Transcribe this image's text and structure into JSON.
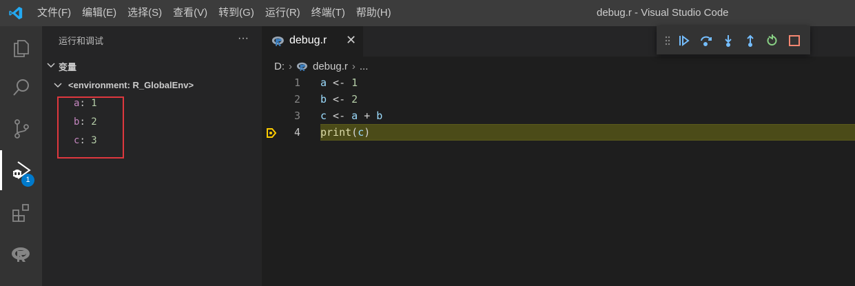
{
  "window": {
    "title": "debug.r - Visual Studio Code"
  },
  "menu": [
    {
      "label": "文件(F)"
    },
    {
      "label": "编辑(E)"
    },
    {
      "label": "选择(S)"
    },
    {
      "label": "查看(V)"
    },
    {
      "label": "转到(G)"
    },
    {
      "label": "运行(R)"
    },
    {
      "label": "终端(T)"
    },
    {
      "label": "帮助(H)"
    }
  ],
  "activitybar": {
    "items": [
      "explorer-icon",
      "search-icon",
      "source-control-icon",
      "run-debug-icon",
      "extensions-icon",
      "r-icon"
    ],
    "debug_badge": "1"
  },
  "sidebar": {
    "header": "运行和调试",
    "more": "···",
    "section": "变量",
    "environment": "<environment: R_GlobalEnv>",
    "variables": [
      {
        "name": "a",
        "value": "1"
      },
      {
        "name": "b",
        "value": "2"
      },
      {
        "name": "c",
        "value": "3"
      }
    ]
  },
  "editor": {
    "tab": {
      "label": "debug.r",
      "close": "✕"
    },
    "breadcrumb": {
      "drive": "D:",
      "file": "debug.r",
      "more": "..."
    },
    "lines": [
      {
        "number": "1",
        "tokens": [
          [
            "a",
            "var"
          ],
          [
            " <- ",
            "op"
          ],
          [
            "1",
            "num"
          ]
        ]
      },
      {
        "number": "2",
        "tokens": [
          [
            "b",
            "var"
          ],
          [
            " <- ",
            "op"
          ],
          [
            "2",
            "num"
          ]
        ]
      },
      {
        "number": "3",
        "tokens": [
          [
            "c",
            "var"
          ],
          [
            " <- ",
            "op"
          ],
          [
            "a",
            "var"
          ],
          [
            " + ",
            "op"
          ],
          [
            "b",
            "var"
          ]
        ]
      },
      {
        "number": "4",
        "tokens": [
          [
            "print",
            "fn"
          ],
          [
            "(",
            "op"
          ],
          [
            "c",
            "var"
          ],
          [
            ")",
            "op"
          ]
        ]
      }
    ],
    "current_line": "4"
  },
  "debug_toolbar": [
    "grip-icon",
    "continue-icon",
    "step-over-icon",
    "step-into-icon",
    "step-out-icon",
    "restart-icon",
    "stop-icon"
  ],
  "colors": {
    "accent": "#007acc",
    "highlight": "#e0383e",
    "current_line": "#4b4b18"
  }
}
